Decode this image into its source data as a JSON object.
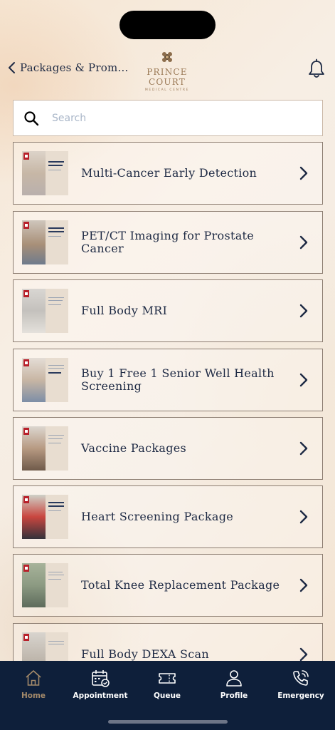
{
  "header": {
    "back_label": "Packages & Prom…",
    "logo_name": "PRINCE COURT",
    "logo_sub": "MEDICAL CENTRE"
  },
  "search": {
    "placeholder": "Search",
    "value": ""
  },
  "packages": [
    {
      "title": "Multi-Cancer Early Detection"
    },
    {
      "title": "PET/CT Imaging for Prostate Cancer"
    },
    {
      "title": "Full Body MRI"
    },
    {
      "title": "Buy 1 Free 1 Senior Well Health Screening"
    },
    {
      "title": "Vaccine Packages"
    },
    {
      "title": "Heart Screening Package"
    },
    {
      "title": "Total Knee Replacement Package"
    },
    {
      "title": "Full Body DEXA Scan"
    }
  ],
  "tabs": [
    {
      "label": "Home",
      "active": true
    },
    {
      "label": "Appointment"
    },
    {
      "label": "Queue"
    },
    {
      "label": "Profile"
    },
    {
      "label": "Emergency"
    }
  ],
  "colors": {
    "navy": "#0e1f3a",
    "text": "#1e2a44",
    "gold": "#a48a6a",
    "card_border": "#8d7e72"
  }
}
